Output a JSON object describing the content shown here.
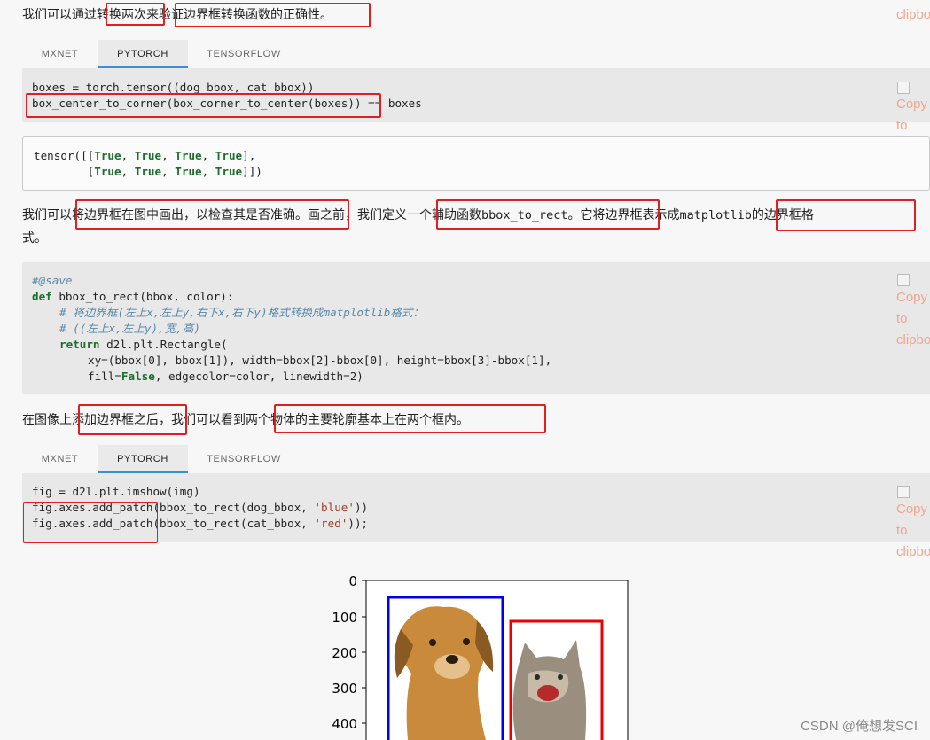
{
  "paragraph1": {
    "text": "我们可以通过转换两次来验证边界框转换函数的正确性。"
  },
  "tabs_top": [
    {
      "label": "MXNET",
      "active": false
    },
    {
      "label": "PYTORCH",
      "active": true
    },
    {
      "label": "TENSORFLOW",
      "active": false
    }
  ],
  "code1": {
    "line1": "boxes = torch.tensor((dog_bbox, cat_bbox))",
    "line2_a": "box_center_to_corner(box_corner_to_center(boxes))",
    "line2_b": " == boxes"
  },
  "output1": {
    "line1_prefix": "tensor([[",
    "line2_prefix": "        [",
    "true_word": "True",
    "sep": ", ",
    "line1_suffix": "],",
    "line2_suffix": "]])"
  },
  "paragraph2": {
    "part1": "我们可以将边界框在图中画出，以检查其是否准确。画之前，我们定义一个辅助函数",
    "func": "bbox_to_rect",
    "part2": "。它将边界框表示成",
    "lib": "matplotlib",
    "part3": "的边界框格",
    "line2": "式。"
  },
  "code2": {
    "comment_save": "#@save",
    "def_kw": "def",
    "def_rest": " bbox_to_rect(bbox, color):",
    "comment1": "# 将边界框(左上x,左上y,右下x,右下y)格式转换成matplotlib格式：",
    "comment2": "# ((左上x,左上y),宽,高)",
    "return_kw": "return",
    "return_rest": " d2l.plt.Rectangle(",
    "xy_line": "xy=(bbox[0], bbox[1]), width=bbox[2]-bbox[0], height=bbox[3]-bbox[1],",
    "fill_a": "fill=",
    "fill_false": "False",
    "fill_b": ", edgecolor=color, linewidth=2)"
  },
  "paragraph3": {
    "text": "在图像上添加边界框之后，我们可以看到两个物体的主要轮廓基本上在两个框内。"
  },
  "tabs_bottom": [
    {
      "label": "MXNET",
      "active": false
    },
    {
      "label": "PYTORCH",
      "active": true
    },
    {
      "label": "TENSORFLOW",
      "active": false
    }
  ],
  "code3": {
    "line1": "fig = d2l.plt.imshow(img)",
    "line2_a": "fig.axes.add_patch(bbox_to_rect(dog_bbox, ",
    "line2_str": "'blue'",
    "line2_b": "))",
    "line3_a": "fig.axes.add_patch(bbox_to_rect(cat_bbox, ",
    "line3_str": "'red'",
    "line3_b": "));"
  },
  "copy_button": {
    "top_text": "clipbo",
    "word1": "Copy",
    "word2": "to",
    "word3": "clipbo"
  },
  "plot": {
    "yticks": [
      "0",
      "100",
      "200",
      "300",
      "400"
    ],
    "dog_box_color": "#0000ee",
    "cat_box_color": "#ee0000"
  },
  "watermark": "CSDN @俺想发SCI",
  "colors": {
    "annotation_red": "#e02020",
    "tab_active_underline": "#3f8ed1",
    "code_bg": "#e8e8e8"
  }
}
